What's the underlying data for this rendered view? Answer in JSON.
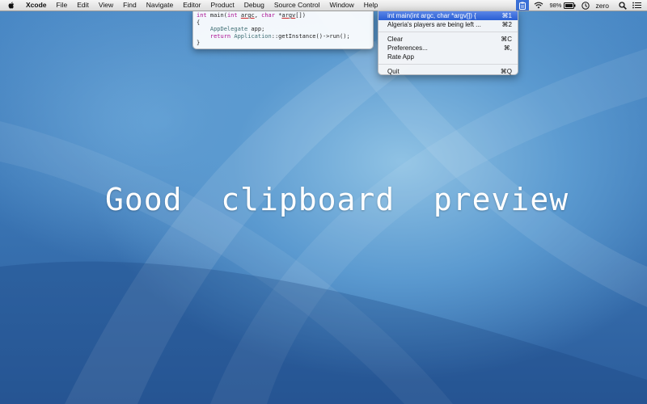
{
  "menubar": {
    "app_name": "Xcode",
    "menus": [
      "File",
      "Edit",
      "View",
      "Find",
      "Navigate",
      "Editor",
      "Product",
      "Debug",
      "Source Control",
      "Window",
      "Help"
    ],
    "status": {
      "battery_percent": "98%",
      "user_name": "zero"
    },
    "icons": [
      "apple-icon",
      "clipboard-icon",
      "wifi-icon",
      "battery-icon",
      "time-machine-icon",
      "user-icon",
      "spotlight-icon",
      "notification-list-icon"
    ]
  },
  "code_preview": {
    "lines": [
      "int main(int argc, char *argv[])",
      "{",
      "    AppDelegate app;",
      "    return Application::getInstance()->run();",
      "}"
    ]
  },
  "clipboard_menu": {
    "items": [
      {
        "label": "int main(int argc, char *argv[]) {",
        "shortcut": "⌘1",
        "highlighted": true
      },
      {
        "label": "Algeria's players are being left ...",
        "shortcut": "⌘2"
      }
    ],
    "actions": [
      {
        "label": "Clear",
        "shortcut": "⌘C"
      },
      {
        "label": "Preferences...",
        "shortcut": "⌘,"
      },
      {
        "label": "Rate App",
        "shortcut": ""
      }
    ],
    "quit": {
      "label": "Quit",
      "shortcut": "⌘Q"
    }
  },
  "tagline": "Good  clipboard  preview",
  "colors": {
    "menu_highlight": "#2a5ed4",
    "wallpaper_base": "#3b77b6",
    "code_keyword": "#aa0d91"
  }
}
